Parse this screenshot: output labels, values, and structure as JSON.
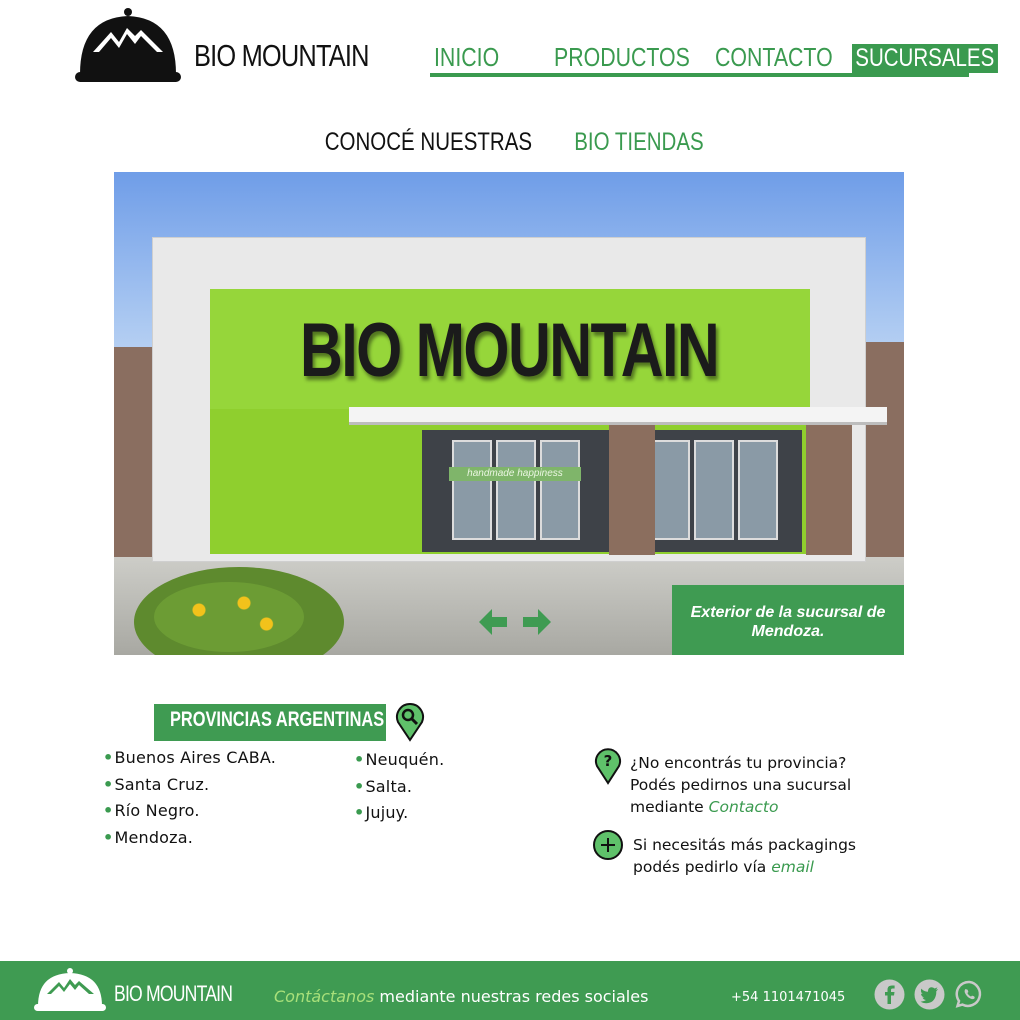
{
  "header": {
    "brand": "BIO MOUNTAIN",
    "nav": [
      {
        "label": "INICIO"
      },
      {
        "label": "PRODUCTOS"
      },
      {
        "label": "CONTACTO"
      },
      {
        "label": "SUCURSALES"
      }
    ],
    "active_nav": "SUCURSALES"
  },
  "headline": {
    "prefix": "CONOCÉ NUESTRAS",
    "highlight": "BIO TIENDAS"
  },
  "hero": {
    "store_sign": "BIO MOUNTAIN",
    "inner_sign": "handmade happiness",
    "caption": "Exterior de la sucursal de Mendoza."
  },
  "provinces": {
    "title": "PROVINCIAS ARGENTINAS",
    "col1": [
      "Buenos Aires CABA.",
      "Santa Cruz.",
      "Río Negro.",
      "Mendoza."
    ],
    "col2": [
      "Neuquén.",
      "Salta.",
      "Jujuy."
    ]
  },
  "info": {
    "missing_line1": "¿No encontrás tu provincia?",
    "missing_line2": "Podés pedirnos una sucursal",
    "missing_line3_prefix": "mediante",
    "missing_link": "Contacto",
    "packaging_line1": "Si necesitás más packagings",
    "packaging_line2_prefix": "podés pedirlo vía",
    "packaging_link": "email"
  },
  "footer": {
    "brand": "BIO MOUNTAIN",
    "cta_link": "Contáctanos",
    "cta_rest": "mediante nuestras redes sociales",
    "phone": "+54 1101471045",
    "social": [
      "facebook-icon",
      "twitter-icon",
      "whatsapp-icon"
    ]
  },
  "colors": {
    "brand_green": "#3f9b52",
    "text_dark": "#111111",
    "link_green": "#3a9a4f"
  }
}
